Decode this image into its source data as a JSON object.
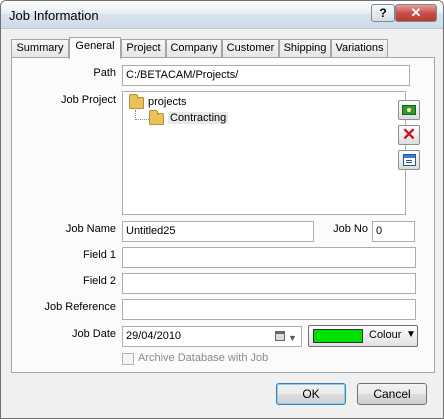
{
  "window": {
    "title": "Job Information",
    "help_label": "?",
    "close_label": "✕"
  },
  "tabs": [
    {
      "label": "Summary"
    },
    {
      "label": "General"
    },
    {
      "label": "Project"
    },
    {
      "label": "Company"
    },
    {
      "label": "Customer"
    },
    {
      "label": "Shipping"
    },
    {
      "label": "Variations"
    }
  ],
  "active_tab": "General",
  "form": {
    "path_label": "Path",
    "path_value": "C:/BETACAM/Projects/",
    "job_project_label": "Job Project",
    "tree": {
      "root": "projects",
      "child": "Contracting"
    },
    "job_name_label": "Job Name",
    "job_name_value": "Untitled25",
    "job_no_label": "Job No",
    "job_no_value": "0",
    "field1_label": "Field 1",
    "field1_value": "",
    "field2_label": "Field 2",
    "field2_value": "",
    "job_reference_label": "Job Reference",
    "job_reference_value": "",
    "job_date_label": "Job Date",
    "job_date_value": "29/04/2010",
    "colour_label": "Colour",
    "colour_value": "#00e000",
    "archive_label": "Archive Database with Job",
    "archive_checked": false
  },
  "side_buttons": [
    "new-folder-icon",
    "delete-icon",
    "properties-icon"
  ],
  "buttons": {
    "ok": "OK",
    "cancel": "Cancel"
  }
}
